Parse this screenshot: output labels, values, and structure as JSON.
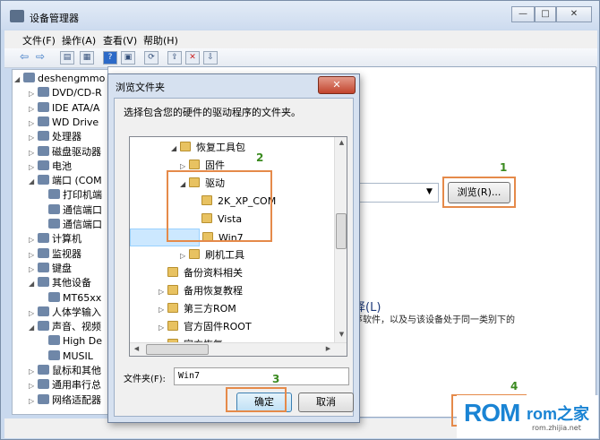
{
  "main_window": {
    "title": "设备管理器",
    "controls": [
      "—",
      "□",
      "✕"
    ],
    "menu": [
      "文件(F)",
      "操作(A)",
      "查看(V)",
      "帮助(H)"
    ],
    "toolbar_icons": [
      "back-icon",
      "forward-icon",
      "view-icon",
      "properties-icon",
      "help-icon",
      "scan-icon",
      "update-driver-icon",
      "uninstall-icon",
      "disable-icon",
      "enable-icon"
    ],
    "tree": [
      {
        "label": "deshengmmo",
        "expander": "◢"
      },
      {
        "label": "DVD/CD-R",
        "expander": "▷"
      },
      {
        "label": "IDE ATA/A",
        "expander": "▷"
      },
      {
        "label": "WD Drive",
        "expander": "▷"
      },
      {
        "label": "处理器",
        "expander": "▷"
      },
      {
        "label": "磁盘驱动器",
        "expander": "▷"
      },
      {
        "label": "电池",
        "expander": "▷"
      },
      {
        "label": "端口 (COM",
        "expander": "◢"
      },
      {
        "label": "打印机端",
        "expander": ""
      },
      {
        "label": "通信端口",
        "expander": ""
      },
      {
        "label": "通信端口",
        "expander": ""
      },
      {
        "label": "计算机",
        "expander": "▷"
      },
      {
        "label": "监视器",
        "expander": "▷"
      },
      {
        "label": "键盘",
        "expander": "▷"
      },
      {
        "label": "其他设备",
        "expander": "◢"
      },
      {
        "label": "MT65xx",
        "expander": ""
      },
      {
        "label": "人体学输入",
        "expander": "▷"
      },
      {
        "label": "声音、视频",
        "expander": "◢"
      },
      {
        "label": "High De",
        "expander": ""
      },
      {
        "label": "MUSIL",
        "expander": ""
      },
      {
        "label": "鼠标和其他",
        "expander": "▷"
      },
      {
        "label": "通用串行总",
        "expander": "▷"
      },
      {
        "label": "网络适配器",
        "expander": "▷"
      }
    ]
  },
  "wizard": {
    "browse_button": "浏览(R)...",
    "option_title": "择(L)",
    "option_desc": "序软件，以及与该设备处于同一类别下的"
  },
  "browse_dialog": {
    "title": "浏览文件夹",
    "close": "✕",
    "prompt": "选择包含您的硬件的驱动程序的文件夹。",
    "folders": [
      {
        "label": "恢复工具包",
        "indent": 46,
        "expander": "◢"
      },
      {
        "label": "固件",
        "indent": 56,
        "expander": "▷"
      },
      {
        "label": "驱动",
        "indent": 56,
        "expander": "◢"
      },
      {
        "label": "2K_XP_COM",
        "indent": 70,
        "expander": ""
      },
      {
        "label": "Vista",
        "indent": 70,
        "expander": ""
      },
      {
        "label": "Win7",
        "indent": 70,
        "expander": "",
        "selected": true
      },
      {
        "label": "刷机工具",
        "indent": 56,
        "expander": "▷"
      },
      {
        "label": "备份资料相关",
        "indent": 32,
        "expander": ""
      },
      {
        "label": "备用恢复教程",
        "indent": 32,
        "expander": "▷"
      },
      {
        "label": "第三方ROM",
        "indent": 32,
        "expander": "▷"
      },
      {
        "label": "官方固件ROOT",
        "indent": 32,
        "expander": "▷"
      },
      {
        "label": "官方恢复",
        "indent": 32,
        "expander": "▷"
      }
    ],
    "folder_label": "文件夹(F):",
    "folder_value": "Win7",
    "ok": "确定",
    "cancel": "取消"
  },
  "annotations": [
    "1",
    "2",
    "3",
    "4"
  ],
  "highlight_color": "#e58a4a",
  "annotation_color": "#3a8a1f",
  "watermark": {
    "logo": "ROM",
    "logo2": "rom之家",
    "url": "rom.zhijia.net"
  }
}
